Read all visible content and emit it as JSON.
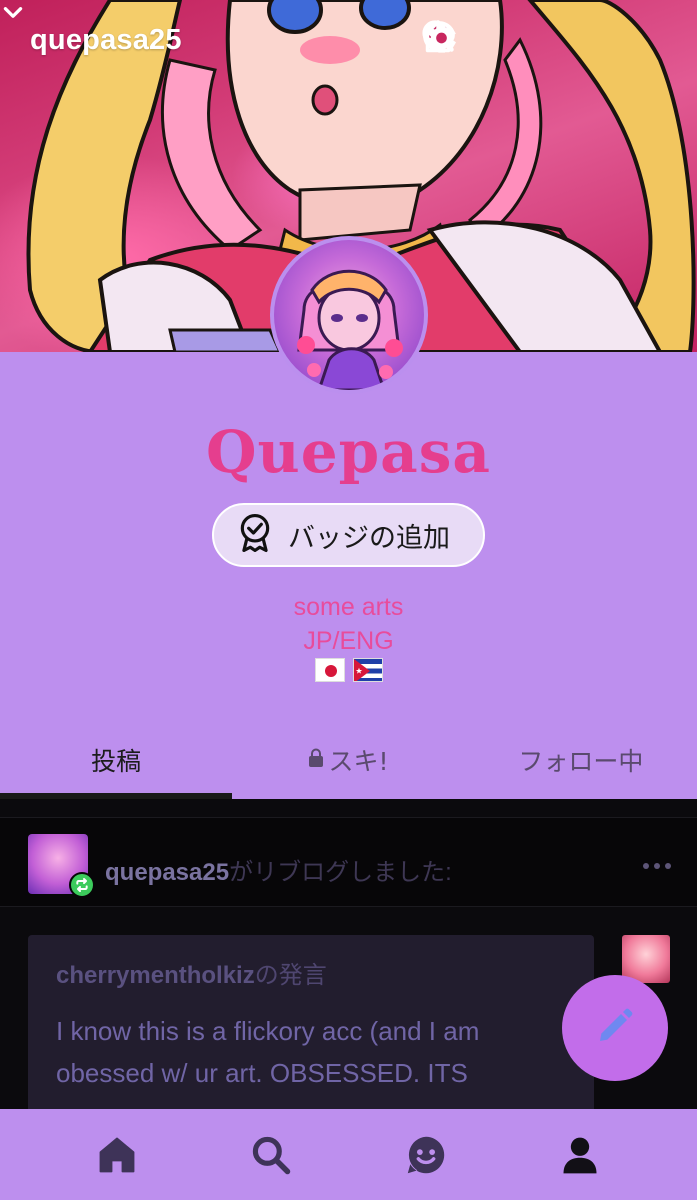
{
  "header": {
    "blog_name": "quepasa25",
    "icons": [
      "chevron-down-icon",
      "search-icon",
      "palette-icon",
      "share-icon",
      "gear-icon"
    ]
  },
  "profile": {
    "title": "Quepasa",
    "badge_button_label": "バッジの追加",
    "description_lines": [
      "some arts",
      "JP/ENG"
    ],
    "flags": [
      "japan-flag",
      "cuba-flag"
    ]
  },
  "tabs": [
    {
      "label": "投稿",
      "active": true
    },
    {
      "label": "スキ!",
      "locked": true
    },
    {
      "label": "フォロー中"
    }
  ],
  "post": {
    "reblogger": "quepasa25",
    "reblog_suffix": "がリブログしました:",
    "source_user": "cherrymentholkiz",
    "source_suffix": "の発言",
    "body_lines": [
      "I know this is a flickory acc (and I am",
      "obessed w/ ur art. OBSESSED. ITS"
    ]
  },
  "bottom_nav": [
    "home-icon",
    "search-icon",
    "activity-icon",
    "account-icon"
  ],
  "colors": {
    "accent_purple": "#bd8fee",
    "title_pink": "#e53e8e",
    "fab": "#c26dea",
    "reblog_green": "#3ccb5c",
    "feed_bg": "#0b0a0d"
  }
}
